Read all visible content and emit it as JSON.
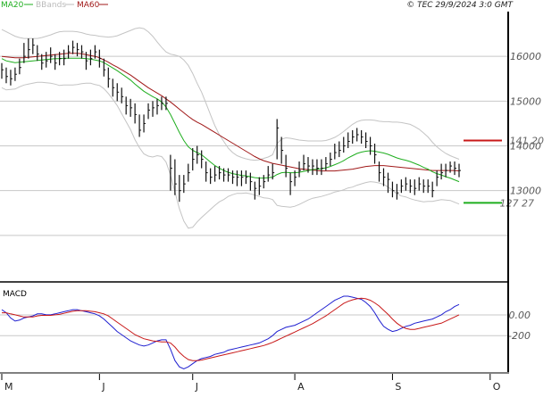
{
  "header": {
    "legend": [
      {
        "label": "MA20",
        "color": "#1fae1f"
      },
      {
        "label": "BBands",
        "color": "#bbbbbb"
      },
      {
        "label": "MA60",
        "color": "#a01818"
      }
    ],
    "copyright": "© TEC 29/9/2024 3:0 GMT"
  },
  "colors": {
    "price_bars": "#111111",
    "ma20": "#1fae1f",
    "bbands": "#c4c4c4",
    "ma60": "#a01818",
    "macd": "#1f1fd0",
    "signal": "#c81818",
    "grid": "#c8c8c8",
    "frame": "#000000"
  },
  "chart_data": [
    {
      "type": "line",
      "panel": "price",
      "y_ticks": [
        13000,
        14000,
        15000,
        16000
      ],
      "y_tick_labels": [
        "13000",
        "14000",
        "15000",
        "16000"
      ],
      "ylim": [
        11000,
        17000
      ],
      "x_ticks": [
        "M",
        "J",
        "J",
        "A",
        "S",
        "O"
      ],
      "x_tick_index": [
        0,
        22,
        43,
        66,
        88,
        110
      ],
      "n_days": 118,
      "price_closes": [
        15700,
        15550,
        15500,
        15600,
        15750,
        16000,
        16150,
        16250,
        16050,
        15850,
        15900,
        16000,
        15850,
        15950,
        15950,
        16100,
        16200,
        16150,
        16100,
        15900,
        15950,
        16100,
        15950,
        15700,
        15500,
        15300,
        15200,
        15100,
        14900,
        14850,
        14700,
        14350,
        14500,
        14800,
        14850,
        14900,
        14950,
        14950,
        13500,
        13150,
        13000,
        13150,
        13400,
        13700,
        13800,
        13700,
        13400,
        13300,
        13350,
        13400,
        13350,
        13350,
        13300,
        13300,
        13300,
        13300,
        13200,
        13050,
        13100,
        13200,
        13350,
        13400,
        14400,
        13900,
        13500,
        13200,
        13300,
        13450,
        13600,
        13550,
        13550,
        13500,
        13500,
        13600,
        13700,
        13850,
        13900,
        14000,
        14100,
        14200,
        14250,
        14200,
        14100,
        14000,
        13800,
        13400,
        13300,
        13250,
        13000,
        12950,
        13100,
        13150,
        13100,
        13050,
        13150,
        13100,
        13100,
        13000,
        13300,
        13400,
        13450,
        13550,
        13500,
        13450
      ],
      "price_ranges": [
        [
          15500,
          15850
        ],
        [
          15400,
          15750
        ],
        [
          15350,
          15700
        ],
        [
          15450,
          15750
        ],
        [
          15600,
          15950
        ],
        [
          15850,
          16300
        ],
        [
          15950,
          16400
        ],
        [
          16050,
          16400
        ],
        [
          15900,
          16250
        ],
        [
          15700,
          16050
        ],
        [
          15750,
          16100
        ],
        [
          15850,
          16200
        ],
        [
          15700,
          16050
        ],
        [
          15800,
          16100
        ],
        [
          15800,
          16150
        ],
        [
          15950,
          16250
        ],
        [
          16050,
          16350
        ],
        [
          16000,
          16300
        ],
        [
          15950,
          16250
        ],
        [
          15700,
          16100
        ],
        [
          15800,
          16150
        ],
        [
          15950,
          16250
        ],
        [
          15750,
          16150
        ],
        [
          15550,
          15950
        ],
        [
          15300,
          15750
        ],
        [
          15100,
          15500
        ],
        [
          15000,
          15400
        ],
        [
          14950,
          15300
        ],
        [
          14700,
          15100
        ],
        [
          14650,
          15050
        ],
        [
          14500,
          14950
        ],
        [
          14200,
          14700
        ],
        [
          14300,
          14700
        ],
        [
          14600,
          14950
        ],
        [
          14650,
          15000
        ],
        [
          14700,
          15050
        ],
        [
          14800,
          15100
        ],
        [
          14800,
          15100
        ],
        [
          13000,
          13800
        ],
        [
          12900,
          13700
        ],
        [
          12750,
          13350
        ],
        [
          12950,
          13350
        ],
        [
          13200,
          13600
        ],
        [
          13450,
          13950
        ],
        [
          13600,
          14000
        ],
        [
          13500,
          13900
        ],
        [
          13200,
          13650
        ],
        [
          13150,
          13500
        ],
        [
          13200,
          13550
        ],
        [
          13250,
          13550
        ],
        [
          13200,
          13500
        ],
        [
          13200,
          13500
        ],
        [
          13150,
          13450
        ],
        [
          13100,
          13450
        ],
        [
          13100,
          13450
        ],
        [
          13150,
          13450
        ],
        [
          13000,
          13400
        ],
        [
          12800,
          13200
        ],
        [
          12900,
          13300
        ],
        [
          13050,
          13350
        ],
        [
          13200,
          13550
        ],
        [
          13250,
          13600
        ],
        [
          13700,
          14600
        ],
        [
          13600,
          14200
        ],
        [
          13300,
          13800
        ],
        [
          12900,
          13400
        ],
        [
          13100,
          13450
        ],
        [
          13300,
          13650
        ],
        [
          13450,
          13800
        ],
        [
          13400,
          13750
        ],
        [
          13350,
          13700
        ],
        [
          13350,
          13700
        ],
        [
          13350,
          13700
        ],
        [
          13450,
          13750
        ],
        [
          13550,
          13850
        ],
        [
          13700,
          14050
        ],
        [
          13750,
          14100
        ],
        [
          13850,
          14200
        ],
        [
          13950,
          14300
        ],
        [
          14050,
          14350
        ],
        [
          14100,
          14400
        ],
        [
          14050,
          14350
        ],
        [
          13950,
          14300
        ],
        [
          13800,
          14200
        ],
        [
          13600,
          14050
        ],
        [
          13200,
          13650
        ],
        [
          13100,
          13500
        ],
        [
          12950,
          13400
        ],
        [
          12850,
          13200
        ],
        [
          12800,
          13150
        ],
        [
          12950,
          13250
        ],
        [
          13000,
          13300
        ],
        [
          12950,
          13250
        ],
        [
          12900,
          13250
        ],
        [
          13000,
          13300
        ],
        [
          12950,
          13250
        ],
        [
          12950,
          13250
        ],
        [
          12850,
          13200
        ],
        [
          13100,
          13450
        ],
        [
          13250,
          13600
        ],
        [
          13300,
          13600
        ],
        [
          13400,
          13650
        ],
        [
          13350,
          13650
        ],
        [
          13300,
          13600
        ]
      ],
      "ma20": [
        15950,
        15900,
        15880,
        15860,
        15870,
        15880,
        15890,
        15900,
        15910,
        15920,
        15930,
        15940,
        15950,
        15950,
        15960,
        15960,
        15960,
        15960,
        15960,
        15950,
        15940,
        15920,
        15900,
        15860,
        15800,
        15740,
        15680,
        15610,
        15540,
        15470,
        15380,
        15300,
        15220,
        15160,
        15100,
        15050,
        14980,
        14870,
        14700,
        14500,
        14300,
        14120,
        13980,
        13900,
        13850,
        13800,
        13720,
        13640,
        13560,
        13500,
        13450,
        13410,
        13380,
        13360,
        13340,
        13330,
        13310,
        13290,
        13280,
        13280,
        13290,
        13300,
        13360,
        13400,
        13410,
        13400,
        13400,
        13410,
        13430,
        13450,
        13470,
        13480,
        13490,
        13510,
        13540,
        13580,
        13620,
        13670,
        13730,
        13780,
        13830,
        13860,
        13880,
        13890,
        13880,
        13860,
        13840,
        13810,
        13770,
        13730,
        13700,
        13680,
        13650,
        13610,
        13570,
        13520,
        13480,
        13420,
        13380,
        13350,
        13310,
        13280,
        13240,
        13200
      ],
      "bb_upper": [
        16600,
        16550,
        16500,
        16450,
        16420,
        16400,
        16400,
        16400,
        16400,
        16420,
        16450,
        16480,
        16520,
        16550,
        16560,
        16560,
        16560,
        16550,
        16530,
        16500,
        16480,
        16470,
        16450,
        16440,
        16430,
        16440,
        16460,
        16500,
        16540,
        16580,
        16620,
        16640,
        16620,
        16550,
        16450,
        16320,
        16200,
        16100,
        16050,
        16030,
        16000,
        15920,
        15800,
        15620,
        15400,
        15200,
        14950,
        14700,
        14450,
        14250,
        14100,
        13950,
        13850,
        13780,
        13740,
        13710,
        13690,
        13680,
        13690,
        13720,
        13750,
        13800,
        14050,
        14150,
        14180,
        14170,
        14150,
        14130,
        14120,
        14110,
        14110,
        14110,
        14110,
        14120,
        14150,
        14190,
        14250,
        14320,
        14400,
        14480,
        14540,
        14570,
        14580,
        14580,
        14570,
        14550,
        14540,
        14540,
        14530,
        14530,
        14520,
        14500,
        14480,
        14430,
        14370,
        14290,
        14200,
        14080,
        13980,
        13900,
        13830,
        13780,
        13740,
        13700
      ],
      "bb_lower": [
        15300,
        15250,
        15260,
        15270,
        15320,
        15360,
        15380,
        15400,
        15420,
        15420,
        15410,
        15400,
        15380,
        15350,
        15360,
        15360,
        15360,
        15370,
        15390,
        15400,
        15400,
        15370,
        15350,
        15280,
        15170,
        15040,
        14900,
        14720,
        14540,
        14360,
        14140,
        13960,
        13820,
        13770,
        13750,
        13780,
        13760,
        13640,
        13350,
        12970,
        12600,
        12320,
        12160,
        12180,
        12300,
        12400,
        12490,
        12580,
        12670,
        12750,
        12800,
        12870,
        12910,
        12940,
        12940,
        12950,
        12930,
        12900,
        12870,
        12840,
        12830,
        12800,
        12670,
        12650,
        12640,
        12630,
        12650,
        12690,
        12740,
        12790,
        12830,
        12850,
        12870,
        12900,
        12930,
        12970,
        12990,
        13020,
        13060,
        13080,
        13120,
        13150,
        13180,
        13200,
        13190,
        13170,
        13140,
        13080,
        13010,
        12930,
        12880,
        12860,
        12820,
        12790,
        12770,
        12750,
        12760,
        12760,
        12780,
        12800,
        12790,
        12780,
        12740,
        12700
      ],
      "ma60": [
        16000,
        15990,
        15980,
        15970,
        15970,
        15970,
        15980,
        15990,
        16000,
        16010,
        16020,
        16030,
        16040,
        16050,
        16060,
        16070,
        16070,
        16070,
        16060,
        16040,
        16020,
        16000,
        15970,
        15920,
        15870,
        15810,
        15760,
        15700,
        15640,
        15580,
        15510,
        15440,
        15370,
        15300,
        15240,
        15180,
        15120,
        15050,
        14980,
        14900,
        14820,
        14740,
        14660,
        14590,
        14530,
        14480,
        14420,
        14360,
        14300,
        14240,
        14180,
        14120,
        14060,
        14000,
        13940,
        13880,
        13820,
        13760,
        13710,
        13670,
        13640,
        13610,
        13590,
        13570,
        13550,
        13530,
        13510,
        13490,
        13480,
        13470,
        13460,
        13450,
        13440,
        13440,
        13440,
        13440,
        13450,
        13460,
        13470,
        13480,
        13500,
        13520,
        13540,
        13550,
        13560,
        13560,
        13560,
        13550,
        13540,
        13530,
        13520,
        13510,
        13500,
        13490,
        13480,
        13470,
        13460,
        13450,
        13450,
        13450,
        13450,
        13450,
        13450,
        13440
      ],
      "annotations": [
        {
          "label": "141 20",
          "value": 14120,
          "color": "#c81818"
        },
        {
          "label": "127 27",
          "value": 12727,
          "color": "#1fae1f"
        }
      ]
    },
    {
      "type": "line",
      "panel": "macd",
      "title": "MACD",
      "y_ticks": [
        0,
        -200
      ],
      "y_tick_labels": [
        "0.00",
        "-200"
      ],
      "ylim": [
        -550,
        300
      ],
      "series": [
        {
          "values": [
            50,
            20,
            -30,
            -60,
            -50,
            -30,
            -20,
            -10,
            10,
            10,
            0,
            0,
            10,
            20,
            30,
            40,
            50,
            50,
            40,
            30,
            20,
            10,
            -10,
            -40,
            -80,
            -120,
            -160,
            -190,
            -220,
            -250,
            -270,
            -290,
            -300,
            -290,
            -270,
            -250,
            -240,
            -240,
            -330,
            -440,
            -500,
            -520,
            -500,
            -470,
            -440,
            -420,
            -410,
            -400,
            -380,
            -370,
            -360,
            -340,
            -330,
            -320,
            -310,
            -300,
            -290,
            -280,
            -270,
            -250,
            -230,
            -200,
            -160,
            -140,
            -120,
            -110,
            -100,
            -80,
            -60,
            -40,
            -10,
            20,
            50,
            80,
            110,
            140,
            160,
            180,
            180,
            170,
            160,
            150,
            120,
            80,
            20,
            -50,
            -110,
            -140,
            -160,
            -150,
            -130,
            -110,
            -100,
            -80,
            -70,
            -60,
            -50,
            -40,
            -20,
            0,
            30,
            50,
            80,
            100
          ]
        },
        {
          "values": [
            20,
            20,
            10,
            0,
            -10,
            -20,
            -20,
            -20,
            -10,
            -5,
            -5,
            -5,
            0,
            5,
            15,
            25,
            35,
            40,
            40,
            40,
            35,
            30,
            20,
            10,
            -10,
            -40,
            -70,
            -100,
            -130,
            -160,
            -190,
            -210,
            -230,
            -240,
            -250,
            -255,
            -260,
            -260,
            -270,
            -310,
            -360,
            -400,
            -430,
            -440,
            -440,
            -435,
            -425,
            -415,
            -405,
            -395,
            -385,
            -375,
            -365,
            -355,
            -345,
            -335,
            -325,
            -315,
            -305,
            -295,
            -280,
            -265,
            -245,
            -225,
            -205,
            -185,
            -165,
            -145,
            -125,
            -105,
            -85,
            -60,
            -35,
            -10,
            20,
            50,
            80,
            110,
            130,
            145,
            155,
            160,
            155,
            140,
            115,
            85,
            45,
            5,
            -40,
            -80,
            -110,
            -130,
            -140,
            -140,
            -130,
            -120,
            -110,
            -100,
            -90,
            -80,
            -60,
            -40,
            -20,
            0
          ]
        }
      ]
    }
  ]
}
